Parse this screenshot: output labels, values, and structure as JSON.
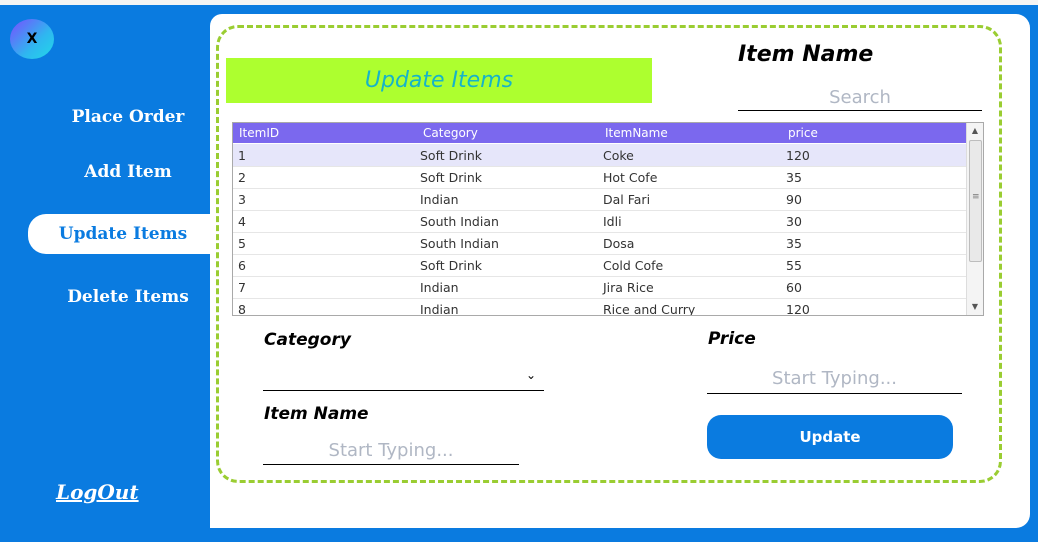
{
  "window": {
    "close_label": "X"
  },
  "sidebar": {
    "items": [
      {
        "label": "Place Order"
      },
      {
        "label": "Add Item"
      },
      {
        "label": "Update Items"
      },
      {
        "label": "Delete Items"
      }
    ],
    "logout": "LogOut"
  },
  "main": {
    "title": "Update Items",
    "search": {
      "label": "Item Name",
      "placeholder": "Search"
    },
    "table": {
      "columns": [
        "ItemID",
        "Category",
        "ItemName",
        "price"
      ],
      "rows": [
        [
          "1",
          "Soft Drink",
          "Coke",
          "120"
        ],
        [
          "2",
          "Soft Drink",
          "Hot Cofe",
          "35"
        ],
        [
          "3",
          "Indian",
          "Dal Fari",
          "90"
        ],
        [
          "4",
          "South Indian",
          "Idli",
          "30"
        ],
        [
          "5",
          "South Indian",
          "Dosa",
          "35"
        ],
        [
          "6",
          "Soft Drink",
          "Cold Cofe",
          "55"
        ],
        [
          "7",
          "Indian",
          "Jira Rice",
          "60"
        ],
        [
          "8",
          "Indian",
          "Rice and Curry",
          "120"
        ]
      ]
    },
    "form": {
      "category_label": "Category",
      "category_value": "",
      "item_name_label": "Item Name",
      "item_name_placeholder": "Start Typing...",
      "price_label": "Price",
      "price_placeholder": "Start Typing...",
      "update_button": "Update"
    }
  },
  "colors": {
    "accent": "#0a7be0",
    "title_bg": "#adff2f",
    "table_header": "#7b68ee",
    "border_dash": "#9acd32"
  }
}
